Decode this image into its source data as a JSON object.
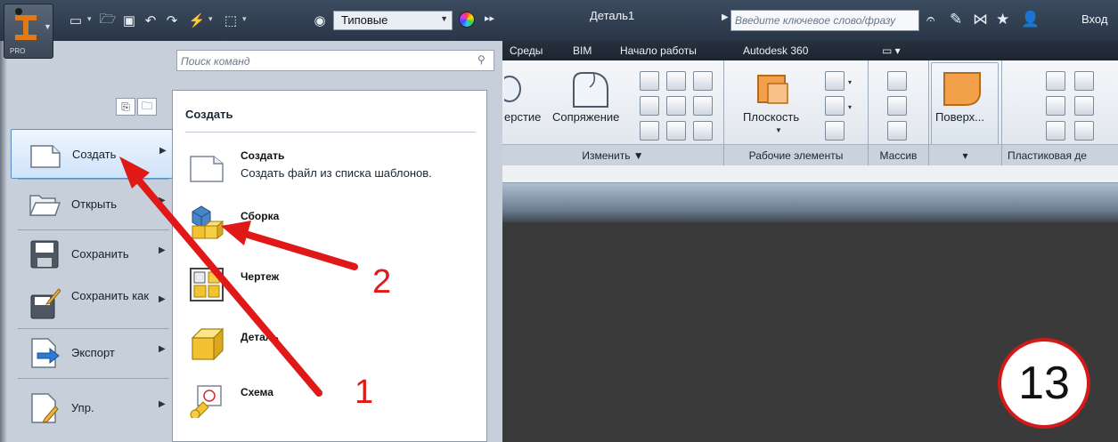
{
  "titlebar": {
    "app_pro": "PRO",
    "style_select": "Типовые",
    "document_title": "Деталь1",
    "keyword_search_placeholder": "Введите ключевое слово/фразу",
    "login": "Вход"
  },
  "ribbon": {
    "tabs": [
      "Среды",
      "BIM",
      "Начало работы",
      "Autodesk 360",
      "▭ ▾"
    ],
    "panels": [
      {
        "title": "Изменить ▼"
      },
      {
        "title": "Рабочие элементы"
      },
      {
        "title": "Массив"
      },
      {
        "title": "▾"
      },
      {
        "title": "Пластиковая де"
      }
    ],
    "labels": {
      "hole": "ерстие",
      "fillet": "Сопряжение",
      "plane": "Плоскость",
      "surface": "Поверх..."
    }
  },
  "appmenu": {
    "search_placeholder": "Поиск команд",
    "items": [
      {
        "label": "Создать",
        "icon": "new-file-icon"
      },
      {
        "label": "Открыть",
        "icon": "open-folder-icon"
      },
      {
        "label": "Сохранить",
        "icon": "save-icon"
      },
      {
        "label": "Сохранить как",
        "icon": "save-as-icon"
      },
      {
        "label": "Экспорт",
        "icon": "export-icon"
      },
      {
        "label": "Упр.",
        "icon": "manage-icon"
      }
    ]
  },
  "submenu": {
    "title": "Создать",
    "entries": [
      {
        "title": "Создать",
        "description": "Создать файл из списка шаблонов.",
        "icon": "new-from-template-icon"
      },
      {
        "title": "Сборка",
        "description": "",
        "icon": "assembly-icon"
      },
      {
        "title": "Чертеж",
        "description": "",
        "icon": "drawing-icon"
      },
      {
        "title": "Деталь",
        "description": "",
        "icon": "part-icon"
      },
      {
        "title": "Схема",
        "description": "",
        "icon": "presentation-icon"
      }
    ]
  },
  "annotations": {
    "arrow_1_label": "1",
    "arrow_2_label": "2",
    "step_badge": "13",
    "accent_color": "#e01818"
  }
}
